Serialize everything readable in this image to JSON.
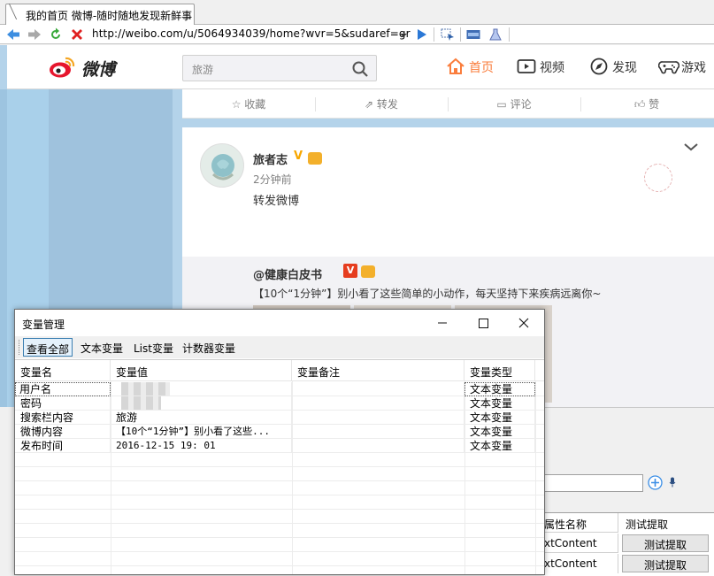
{
  "browser": {
    "tab_title": "我的首页 微博-随时随地发现新鲜事",
    "url": "http://weibo.com/u/5064934039/home?wvr=5&sudaref=gr"
  },
  "weibo": {
    "logo_text": "微博",
    "search_placeholder": "旅游",
    "nav": {
      "home": "首页",
      "video": "视频",
      "discover": "发现",
      "game": "游戏"
    },
    "actions": {
      "favorite": "收藏",
      "repost": "转发",
      "comment": "评论",
      "like": "赞"
    },
    "post": {
      "author": "旅者志",
      "time": "2分钟前",
      "text": "转发微博",
      "repost_author": "@健康白皮书",
      "repost_badge": "V",
      "repost_text": "【10个“1分钟”】别小看了这些简单的小动作，每天坚持下来疾病远离你~"
    }
  },
  "dialog": {
    "title": "变量管理",
    "tabs": [
      "查看全部",
      "文本变量",
      "List变量",
      "计数器变量"
    ],
    "columns": [
      "变量名",
      "变量值",
      "变量备注",
      "变量类型"
    ],
    "rows": [
      {
        "name": "用户名",
        "value": "",
        "note": "",
        "type": "文本变量"
      },
      {
        "name": "密码",
        "value": "",
        "note": "",
        "type": "文本变量"
      },
      {
        "name": "搜索栏内容",
        "value": "旅游",
        "note": "",
        "type": "文本变量"
      },
      {
        "name": "微博内容",
        "value": "【10个“1分钟”】别小看了这些...",
        "note": "",
        "type": "文本变量"
      },
      {
        "name": "发布时间",
        "value": "2016-12-15 19: 01",
        "note": "",
        "type": "文本变量"
      }
    ]
  },
  "background_panel": {
    "header_attr": "属性名称",
    "header_action": "测试提取",
    "rows": [
      {
        "attr": "xtContent",
        "button": "测试提取"
      },
      {
        "attr": "xtContent",
        "button": "测试提取"
      }
    ]
  },
  "colors": {
    "weibo_orange": "#fa7d3c",
    "page_blue": "#b4d3ea",
    "verified_red": "#e63d1f"
  }
}
